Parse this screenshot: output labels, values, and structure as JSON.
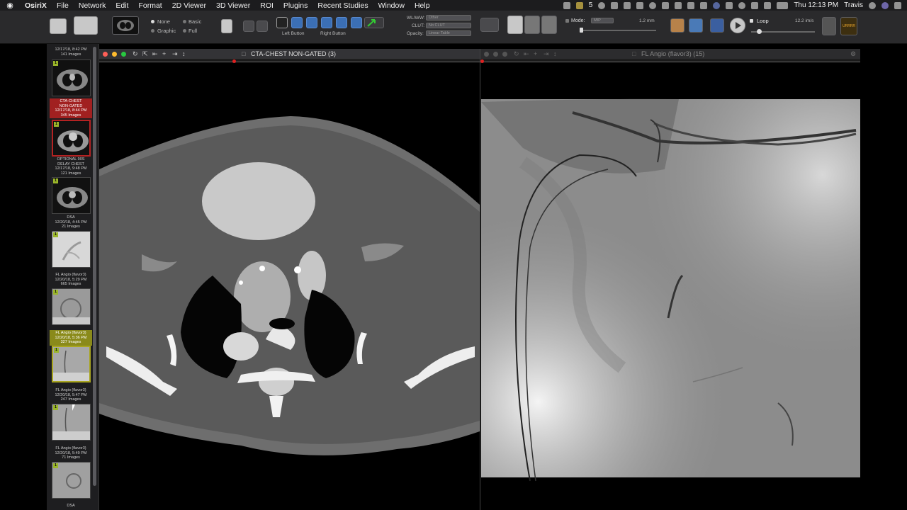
{
  "menubar": {
    "app": "OsiriX",
    "items": [
      "File",
      "Network",
      "Edit",
      "Format",
      "2D Viewer",
      "3D Viewer",
      "ROI",
      "Plugins",
      "Recent Studies",
      "Window",
      "Help"
    ],
    "status_number": "5",
    "clock": "Thu 12:13 PM",
    "user": "Travis"
  },
  "toolbar": {
    "annotations": {
      "none": "None",
      "basic": "Basic",
      "graphic": "Graphic",
      "full": "Full"
    },
    "mouse": {
      "left": "Left Button",
      "right": "Right Button"
    },
    "wlww_label": "WL/WW:",
    "wlww_value": "Other",
    "clut_label": "CLUT:",
    "clut_value": "No CLUT",
    "opacity_label": "Opacity:",
    "opacity_value": "Linear Table",
    "mode_label": "Mode:",
    "mode_value": "MIP",
    "thickness": "1.2 mm",
    "loop_label": "Loop",
    "frame_rate": "12.2 im/s",
    "mpr_badge": "URRRR"
  },
  "series": [
    {
      "label": "12/17/18, 8:42 PM\n141 Images",
      "state": "normal"
    },
    {
      "label": "CTA-CHEST\nNON-GATED\n12/17/18, 8:44 PM\n345 Images",
      "state": "red"
    },
    {
      "label": "OPTIONAL 90S\nDELAY CHEST\n12/17/18, 9:48 PM\n121 Images",
      "state": "normal"
    },
    {
      "label": "DSA\n12/20/18, 4:45 PM\n21 Images",
      "state": "normal"
    },
    {
      "label": "FL Angio (flavor3)\n12/20/18, 5:29 PM\n665 Images",
      "state": "normal"
    },
    {
      "label": "FL Angio (flavor3)\n12/20/18, 5:36 PM\n327 Images",
      "state": "yellow"
    },
    {
      "label": "FL Angio (flavor3)\n12/20/18, 5:47 PM\n247 Images",
      "state": "normal"
    },
    {
      "label": "FL Angio (flavor3)\n12/20/18, 5:49 PM\n71 Images",
      "state": "normal"
    },
    {
      "label": "DSA",
      "state": "normal"
    }
  ],
  "badge_number": "1",
  "viewers": {
    "left_title": "CTA-CHEST NON-GATED (3)",
    "right_title": "FL Angio (flavor3) (15)",
    "left_progress": 0.35,
    "right_progress": 0.0
  },
  "colors": {
    "selected_red": "#b42222",
    "selected_yellow": "#a9a61f",
    "badge": "#9ab52a"
  }
}
